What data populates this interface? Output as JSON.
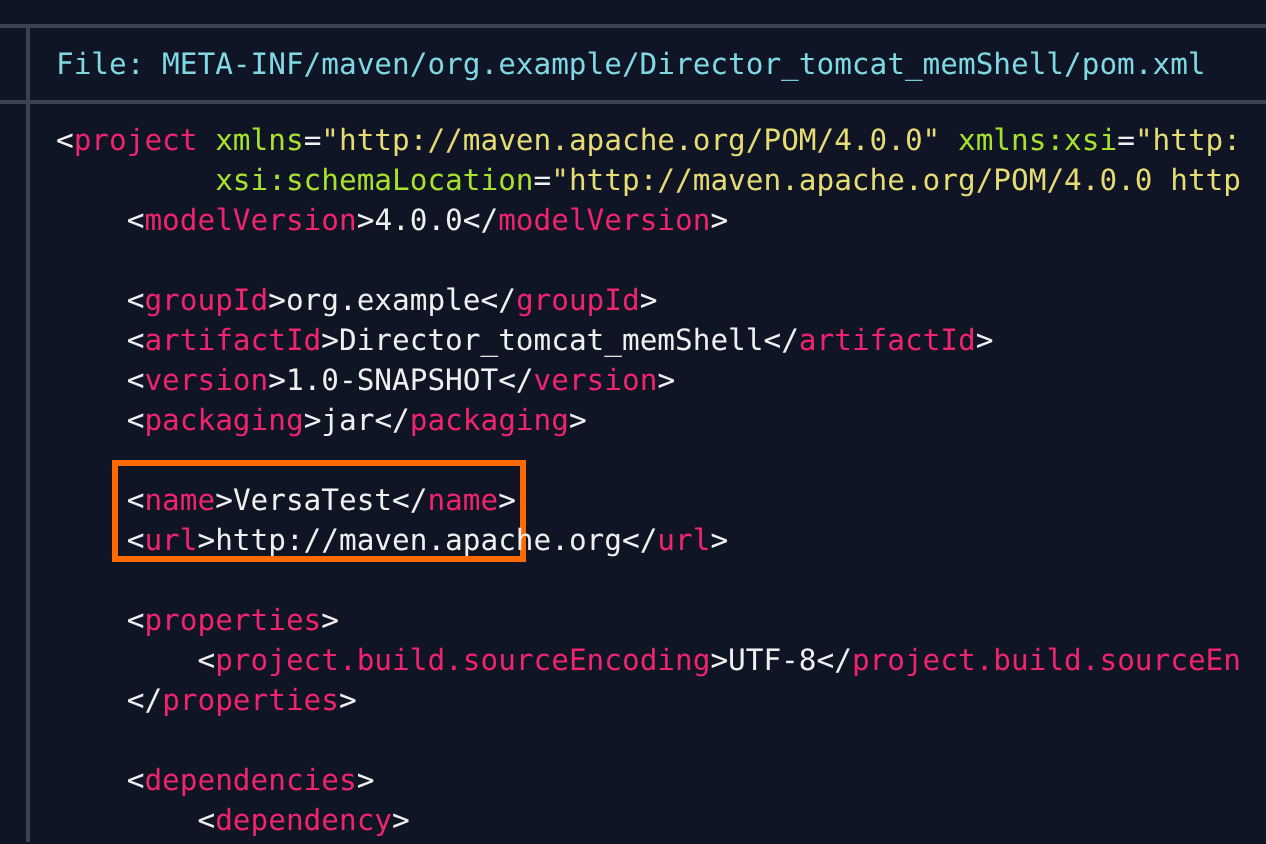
{
  "file_header": "File: META-INF/maven/org.example/Director_tomcat_memShell/pom.xml",
  "code_lines": [
    {
      "kind": "code",
      "tokens": [
        {
          "kind": "punct",
          "text": "<"
        },
        {
          "kind": "tag",
          "text": "project"
        },
        {
          "kind": "attr",
          "text": " xmlns"
        },
        {
          "kind": "punct",
          "text": "="
        },
        {
          "kind": "string",
          "text": "\"http://maven.apache.org/POM/4.0.0\""
        },
        {
          "kind": "attr",
          "text": " xmlns:xsi"
        },
        {
          "kind": "punct",
          "text": "="
        },
        {
          "kind": "string",
          "text": "\"http:"
        }
      ]
    },
    {
      "kind": "code",
      "tokens": [
        {
          "kind": "attr",
          "text": "         xsi:schemaLocation"
        },
        {
          "kind": "punct",
          "text": "="
        },
        {
          "kind": "string",
          "text": "\"http://maven.apache.org/POM/4.0.0 http"
        }
      ]
    },
    {
      "kind": "code",
      "tokens": [
        {
          "kind": "punct",
          "text": "    <"
        },
        {
          "kind": "tag",
          "text": "modelVersion"
        },
        {
          "kind": "punct",
          "text": ">"
        },
        {
          "kind": "text",
          "text": "4.0.0"
        },
        {
          "kind": "punct",
          "text": "</"
        },
        {
          "kind": "tag",
          "text": "modelVersion"
        },
        {
          "kind": "punct",
          "text": ">"
        }
      ]
    },
    {
      "kind": "blank"
    },
    {
      "kind": "code",
      "tokens": [
        {
          "kind": "punct",
          "text": "    <"
        },
        {
          "kind": "tag",
          "text": "groupId"
        },
        {
          "kind": "punct",
          "text": ">"
        },
        {
          "kind": "text",
          "text": "org.example"
        },
        {
          "kind": "punct",
          "text": "</"
        },
        {
          "kind": "tag",
          "text": "groupId"
        },
        {
          "kind": "punct",
          "text": ">"
        }
      ]
    },
    {
      "kind": "code",
      "tokens": [
        {
          "kind": "punct",
          "text": "    <"
        },
        {
          "kind": "tag",
          "text": "artifactId"
        },
        {
          "kind": "punct",
          "text": ">"
        },
        {
          "kind": "text",
          "text": "Director_tomcat_memShell"
        },
        {
          "kind": "punct",
          "text": "</"
        },
        {
          "kind": "tag",
          "text": "artifactId"
        },
        {
          "kind": "punct",
          "text": ">"
        }
      ]
    },
    {
      "kind": "code",
      "tokens": [
        {
          "kind": "punct",
          "text": "    <"
        },
        {
          "kind": "tag",
          "text": "version"
        },
        {
          "kind": "punct",
          "text": ">"
        },
        {
          "kind": "text",
          "text": "1.0-SNAPSHOT"
        },
        {
          "kind": "punct",
          "text": "</"
        },
        {
          "kind": "tag",
          "text": "version"
        },
        {
          "kind": "punct",
          "text": ">"
        }
      ]
    },
    {
      "kind": "code",
      "tokens": [
        {
          "kind": "punct",
          "text": "    <"
        },
        {
          "kind": "tag",
          "text": "packaging"
        },
        {
          "kind": "punct",
          "text": ">"
        },
        {
          "kind": "text",
          "text": "jar"
        },
        {
          "kind": "punct",
          "text": "</"
        },
        {
          "kind": "tag",
          "text": "packaging"
        },
        {
          "kind": "punct",
          "text": ">"
        }
      ]
    },
    {
      "kind": "blank"
    },
    {
      "kind": "code",
      "highlighted": true,
      "tokens": [
        {
          "kind": "punct",
          "text": "    <"
        },
        {
          "kind": "tag",
          "text": "name"
        },
        {
          "kind": "punct",
          "text": ">"
        },
        {
          "kind": "text",
          "text": "VersaTest"
        },
        {
          "kind": "punct",
          "text": "</"
        },
        {
          "kind": "tag",
          "text": "name"
        },
        {
          "kind": "punct",
          "text": ">"
        }
      ]
    },
    {
      "kind": "code",
      "tokens": [
        {
          "kind": "punct",
          "text": "    <"
        },
        {
          "kind": "tag",
          "text": "url"
        },
        {
          "kind": "punct",
          "text": ">"
        },
        {
          "kind": "text",
          "text": "http://maven.apache.org"
        },
        {
          "kind": "punct",
          "text": "</"
        },
        {
          "kind": "tag",
          "text": "url"
        },
        {
          "kind": "punct",
          "text": ">"
        }
      ]
    },
    {
      "kind": "blank"
    },
    {
      "kind": "code",
      "tokens": [
        {
          "kind": "punct",
          "text": "    <"
        },
        {
          "kind": "tag",
          "text": "properties"
        },
        {
          "kind": "punct",
          "text": ">"
        }
      ]
    },
    {
      "kind": "code",
      "tokens": [
        {
          "kind": "punct",
          "text": "        <"
        },
        {
          "kind": "tag",
          "text": "project.build.sourceEncoding"
        },
        {
          "kind": "punct",
          "text": ">"
        },
        {
          "kind": "text",
          "text": "UTF-8"
        },
        {
          "kind": "punct",
          "text": "</"
        },
        {
          "kind": "tag",
          "text": "project.build.sourceEn"
        }
      ]
    },
    {
      "kind": "code",
      "tokens": [
        {
          "kind": "punct",
          "text": "    </"
        },
        {
          "kind": "tag",
          "text": "properties"
        },
        {
          "kind": "punct",
          "text": ">"
        }
      ]
    },
    {
      "kind": "blank"
    },
    {
      "kind": "code",
      "tokens": [
        {
          "kind": "punct",
          "text": "    <"
        },
        {
          "kind": "tag",
          "text": "dependencies"
        },
        {
          "kind": "punct",
          "text": ">"
        }
      ]
    },
    {
      "kind": "code",
      "tokens": [
        {
          "kind": "punct",
          "text": "        <"
        },
        {
          "kind": "tag",
          "text": "dependency"
        },
        {
          "kind": "punct",
          "text": ">"
        }
      ]
    }
  ]
}
